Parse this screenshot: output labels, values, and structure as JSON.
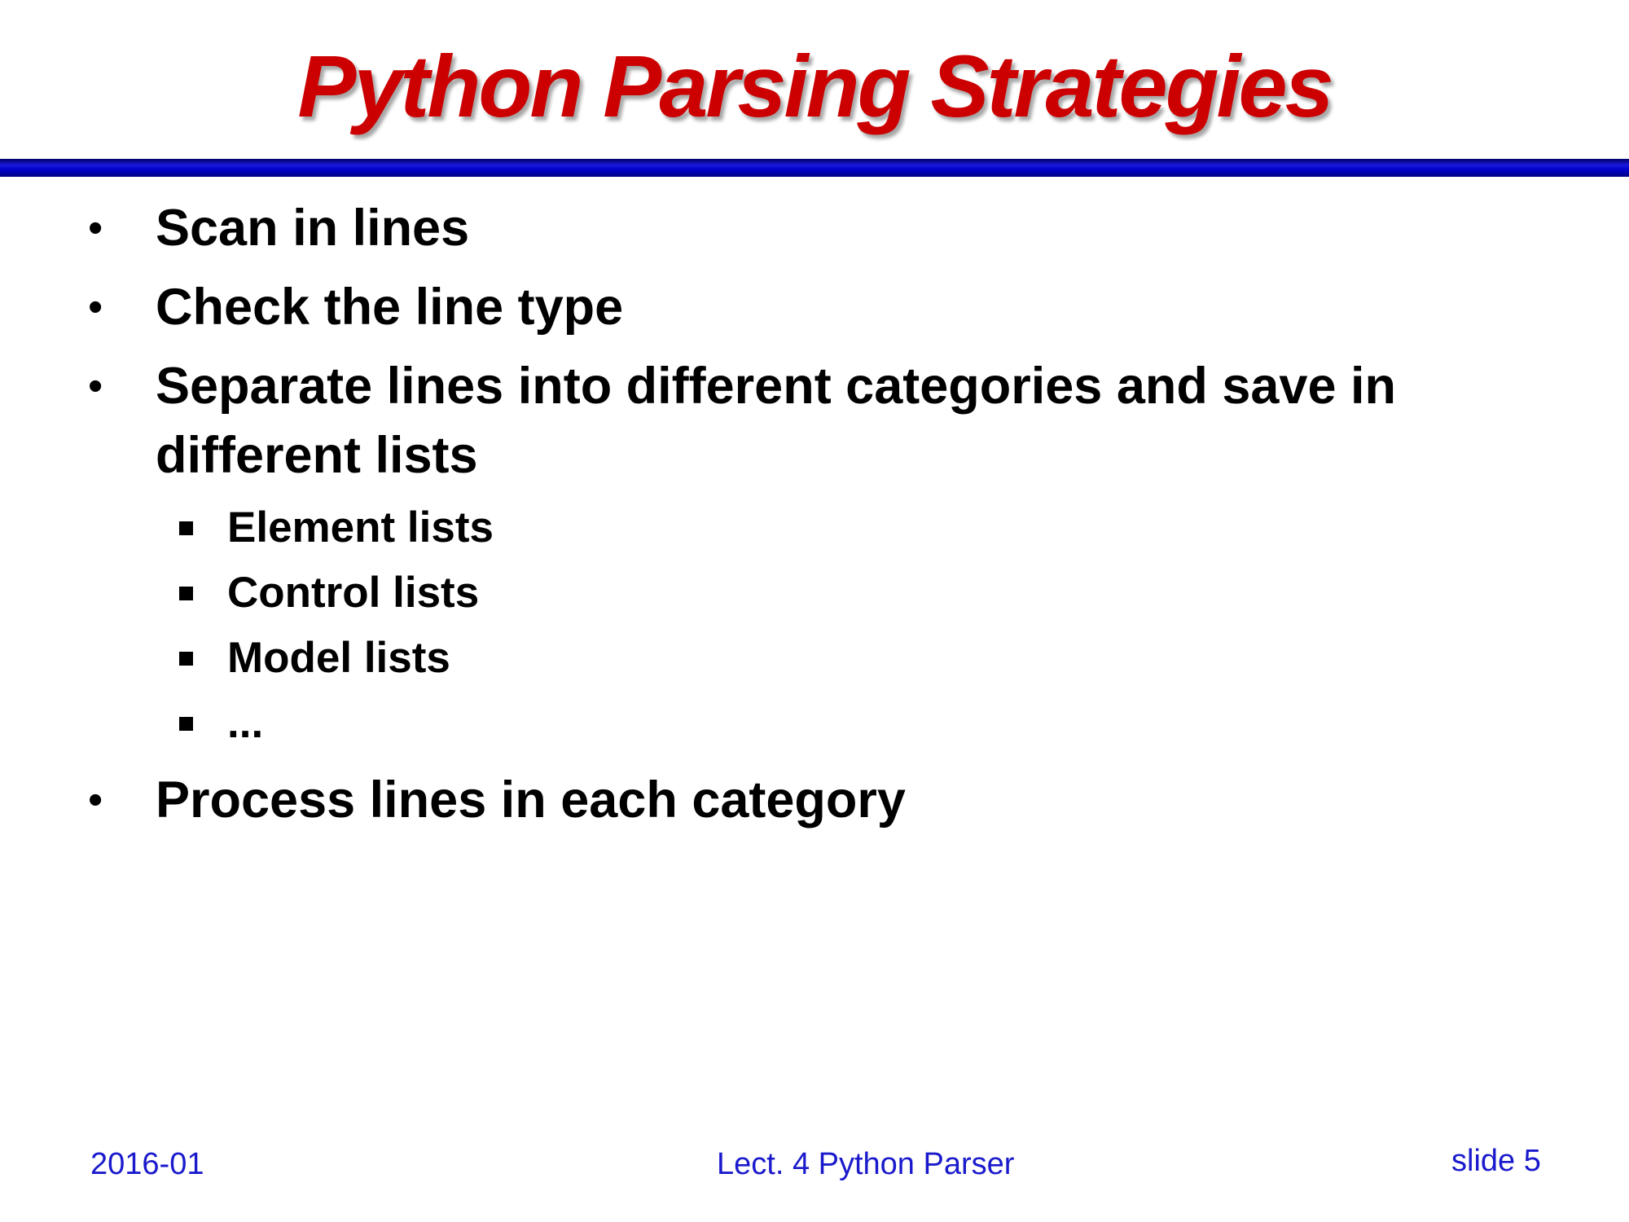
{
  "slide": {
    "title": "Python Parsing Strategies",
    "bullets": [
      {
        "text": "Scan in lines"
      },
      {
        "text": "Check the line type"
      },
      {
        "text": "Separate lines into different categories and save in different lists",
        "subitems": [
          "Element lists",
          "Control lists",
          "Model lists",
          "..."
        ]
      },
      {
        "text": "Process lines in each category"
      }
    ],
    "footer": {
      "date": "2016-01",
      "lecture": "Lect. 4 Python Parser",
      "slide_number": "slide 5"
    }
  },
  "colors": {
    "title": "#cc0000",
    "rule": "#0000cc",
    "footer_text": "#1a1acc",
    "body_text": "#000000"
  },
  "icons": {
    "bullet": "round-bullet",
    "sub_bullet": "square-bullet"
  }
}
